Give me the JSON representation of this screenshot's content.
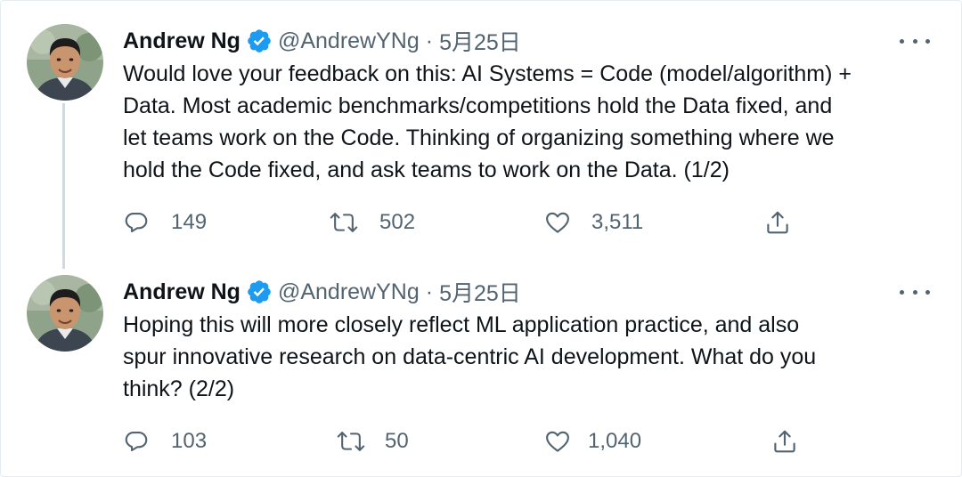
{
  "thread": {
    "tweets": [
      {
        "author_name": "Andrew Ng",
        "handle": "@AndrewYNg",
        "separator": "·",
        "date": "5月25日",
        "text_lines": [
          "Would love your feedback on this: AI Systems = Code (model/algorithm) +",
          "Data. Most academic benchmarks/competitions hold the Data fixed, and",
          "let teams work on the Code. Thinking of organizing something where we",
          "hold the Code fixed, and ask teams to work on the Data. (1/2)"
        ],
        "replies": "149",
        "retweets": "502",
        "likes": "3,511"
      },
      {
        "author_name": "Andrew Ng",
        "handle": "@AndrewYNg",
        "separator": "·",
        "date": "5月25日",
        "text_lines": [
          "Hoping this will more closely reflect ML application practice, and also",
          "spur innovative research on data-centric AI development. What do you",
          "think? (2/2)"
        ],
        "replies": "103",
        "retweets": "50",
        "likes": "1,040"
      }
    ]
  },
  "icons": {
    "verified": "verified-badge-icon",
    "more": "more-options-icon",
    "reply": "reply-icon",
    "retweet": "retweet-icon",
    "like": "heart-icon",
    "share": "share-icon"
  },
  "colors": {
    "verified_blue": "#1d9bf0",
    "text": "#0f1419",
    "secondary": "#536471",
    "thread_line": "#cfd9de"
  }
}
